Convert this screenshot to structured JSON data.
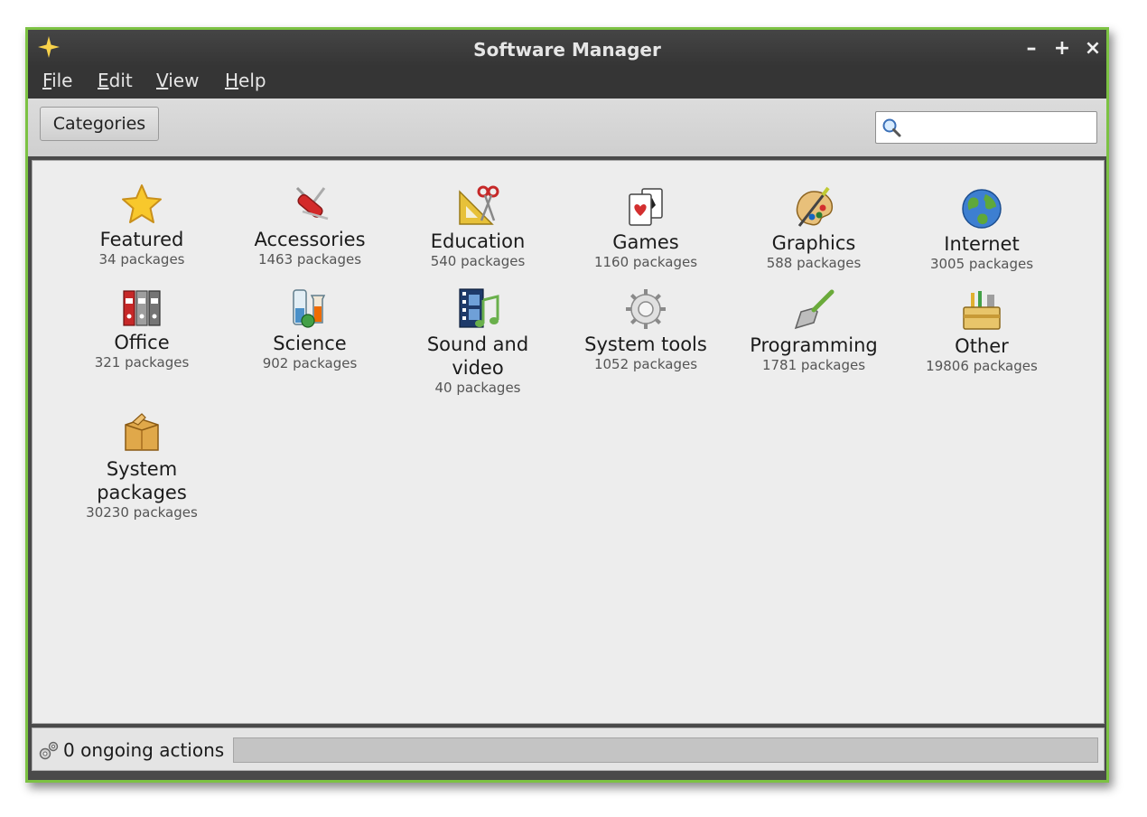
{
  "window": {
    "title": "Software Manager",
    "accent_color": "#7cc243",
    "controls": {
      "minimize": "–",
      "maximize": "+",
      "close": "×"
    }
  },
  "menu": [
    {
      "label": "File",
      "mnemonic": "F",
      "rest": "ile"
    },
    {
      "label": "Edit",
      "mnemonic": "E",
      "rest": "dit"
    },
    {
      "label": "View",
      "mnemonic": "V",
      "rest": "iew"
    },
    {
      "label": "Help",
      "mnemonic": "H",
      "rest": "elp"
    }
  ],
  "toolbar": {
    "categories_label": "Categories",
    "search": {
      "value": "",
      "placeholder": "",
      "icon": "search-icon"
    }
  },
  "categories": [
    {
      "label": "Featured",
      "count": "34 packages",
      "icon": "star-icon"
    },
    {
      "label": "Accessories",
      "count": "1463 packages",
      "icon": "swiss-knife-icon"
    },
    {
      "label": "Education",
      "count": "540 packages",
      "icon": "ruler-scissors-icon"
    },
    {
      "label": "Games",
      "count": "1160 packages",
      "icon": "playing-cards-icon"
    },
    {
      "label": "Graphics",
      "count": "588 packages",
      "icon": "paint-palette-icon"
    },
    {
      "label": "Internet",
      "count": "3005 packages",
      "icon": "globe-icon"
    },
    {
      "label": "Office",
      "count": "321 packages",
      "icon": "binders-icon"
    },
    {
      "label": "Science",
      "count": "902 packages",
      "icon": "flask-icon"
    },
    {
      "label": "Sound and video",
      "label_lines": [
        "Sound and",
        "video"
      ],
      "count": "40 packages",
      "icon": "film-music-icon"
    },
    {
      "label": "System tools",
      "count": "1052 packages",
      "icon": "gear-icon"
    },
    {
      "label": "Programming",
      "count": "1781 packages",
      "icon": "trowel-icon"
    },
    {
      "label": "Other",
      "count": "19806 packages",
      "icon": "toolbox-icon"
    },
    {
      "label": "System packages",
      "label_lines": [
        "System",
        "packages"
      ],
      "count": "30230 packages",
      "icon": "package-box-icon"
    }
  ],
  "status": {
    "text": "0 ongoing actions",
    "icon": "gears-icon",
    "progress_fraction": 0
  }
}
